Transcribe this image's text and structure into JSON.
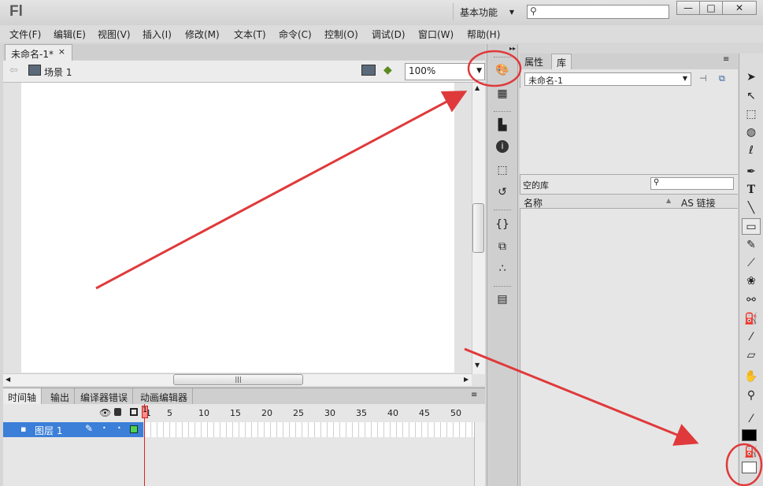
{
  "app": {
    "logo": "Fl",
    "workspace": "基本功能",
    "workspace_arrow": "▼",
    "search_icon": "search-icon",
    "window_buttons": {
      "minimize": "—",
      "maximize": "□",
      "close": "✕"
    }
  },
  "menu": [
    "文件(F)",
    "编辑(E)",
    "视图(V)",
    "插入(I)",
    "修改(M)",
    "文本(T)",
    "命令(C)",
    "控制(O)",
    "调试(D)",
    "窗口(W)",
    "帮助(H)"
  ],
  "document": {
    "tab_title": "未命名-1*",
    "tab_close": "×",
    "scene": "场景 1",
    "zoom": "100%"
  },
  "timeline": {
    "tabs": [
      "时间轴",
      "输出",
      "编译器错误",
      "动画编辑器"
    ],
    "frame_numbers": [
      "1",
      "5",
      "10",
      "15",
      "20",
      "25",
      "30",
      "35",
      "40",
      "45",
      "50"
    ],
    "layer_name": "图层 1",
    "current_frame": "1"
  },
  "library": {
    "tabs": [
      "属性",
      "库"
    ],
    "active_tab": "库",
    "doc_select": "未命名-1",
    "empty_label": "空的库",
    "col_name": "名称",
    "col_linkage": "AS 链接"
  },
  "colors": {
    "annotation": "#e0393b",
    "layer_selected": "#3b7fd8",
    "playhead": "#dd2222"
  },
  "icons": {
    "strip": [
      "color-palette-icon",
      "swatches-icon",
      "align-icon",
      "info-icon",
      "transform-icon",
      "history-icon",
      "code-snippets-icon",
      "components-icon",
      "motion-presets-icon",
      "project-icon"
    ],
    "tools": [
      "selection-tool-icon",
      "subselection-tool-icon",
      "free-transform-icon",
      "3d-rotation-icon",
      "lasso-icon",
      "pen-icon",
      "text-tool-icon",
      "line-tool-icon",
      "rectangle-tool-icon",
      "pencil-icon",
      "brush-icon",
      "deco-icon",
      "bone-icon",
      "paint-bucket-icon",
      "eyedropper-icon",
      "eraser-icon",
      "hand-icon",
      "zoom-tool-icon",
      "stroke-color-icon",
      "fill-color-icon"
    ]
  }
}
